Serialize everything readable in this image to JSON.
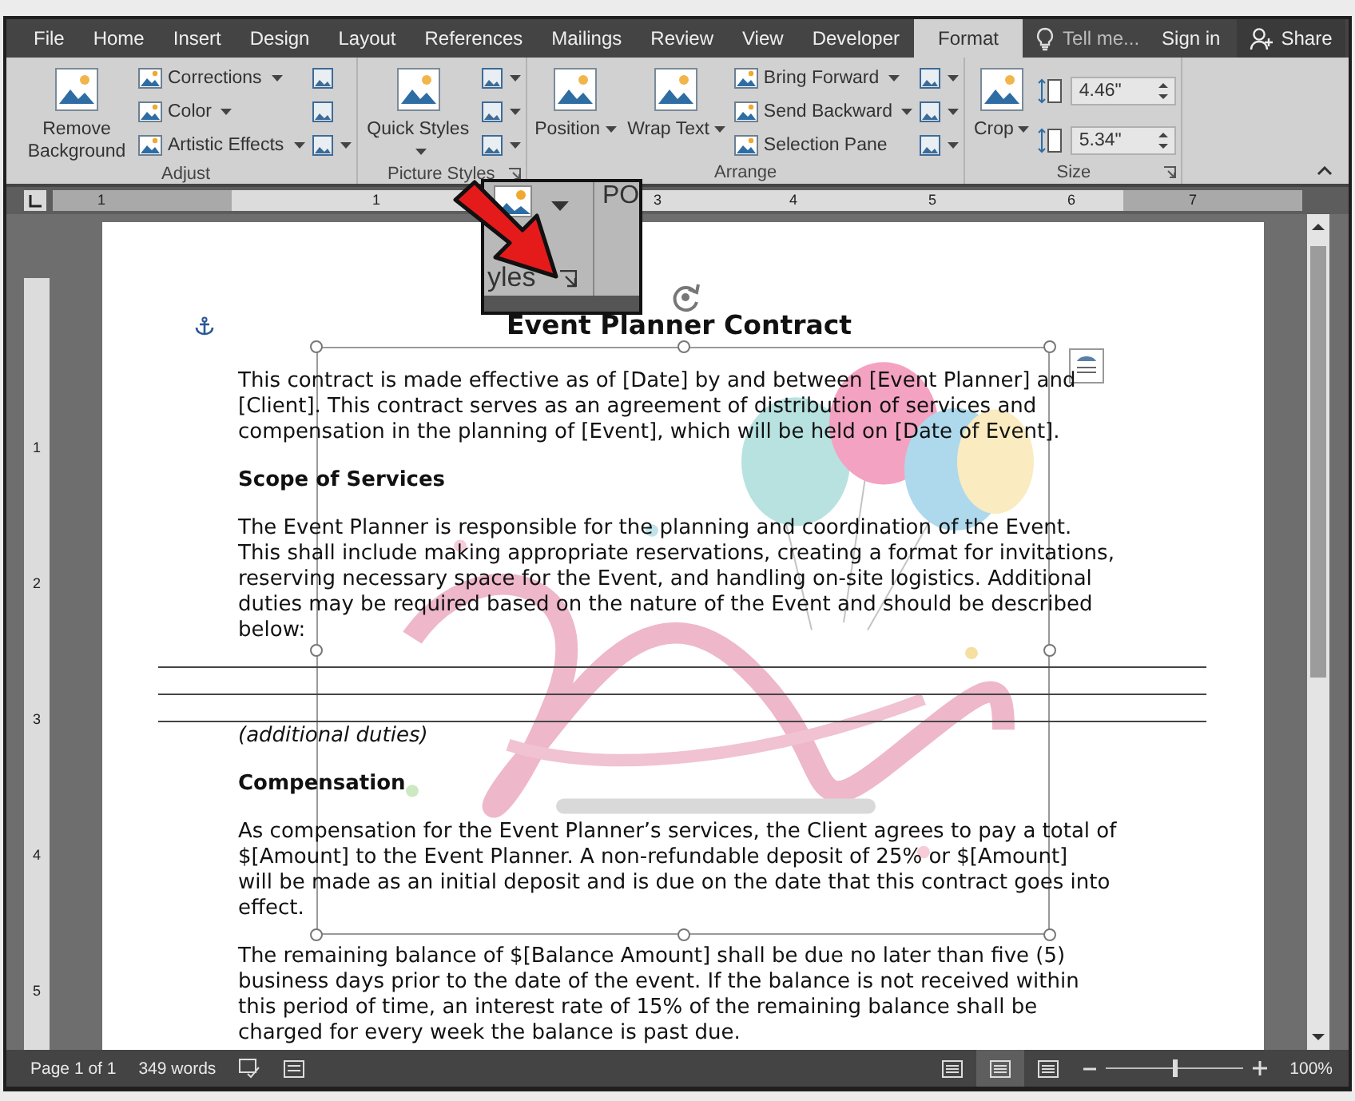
{
  "tabs": [
    {
      "label": "File",
      "selected": false
    },
    {
      "label": "Home",
      "selected": false
    },
    {
      "label": "Insert",
      "selected": false
    },
    {
      "label": "Design",
      "selected": false
    },
    {
      "label": "Layout",
      "selected": false
    },
    {
      "label": "References",
      "selected": false
    },
    {
      "label": "Mailings",
      "selected": false
    },
    {
      "label": "Review",
      "selected": false
    },
    {
      "label": "View",
      "selected": false
    },
    {
      "label": "Developer",
      "selected": false
    },
    {
      "label": "Format",
      "selected": true
    }
  ],
  "tell_me": {
    "placeholder": "Tell me..."
  },
  "account": {
    "sign_in": "Sign in",
    "share": "Share"
  },
  "ribbon": {
    "groups": [
      {
        "label": "Adjust",
        "launcher": false,
        "items": [
          {
            "kind": "large",
            "label": "Remove Background",
            "dropdown": false
          },
          {
            "kind": "column",
            "buttons": [
              {
                "label": "Corrections",
                "dropdown": true
              },
              {
                "label": "Color",
                "dropdown": true
              },
              {
                "label": "Artistic Effects",
                "dropdown": true
              }
            ]
          },
          {
            "kind": "icons",
            "buttons": [
              {
                "dropdown": false
              },
              {
                "dropdown": false
              },
              {
                "dropdown": true
              }
            ]
          }
        ]
      },
      {
        "label": "Picture Styles",
        "launcher": true,
        "items": [
          {
            "kind": "large",
            "label": "Quick Styles",
            "dropdown": true
          },
          {
            "kind": "icons",
            "buttons": [
              {
                "dropdown": true
              },
              {
                "dropdown": true
              },
              {
                "dropdown": true
              }
            ]
          }
        ]
      },
      {
        "label": "Arrange",
        "launcher": false,
        "items": [
          {
            "kind": "large",
            "label": "Position",
            "dropdown": true
          },
          {
            "kind": "large",
            "label": "Wrap Text",
            "dropdown": true
          },
          {
            "kind": "column",
            "buttons": [
              {
                "label": "Bring Forward",
                "dropdown": true
              },
              {
                "label": "Send Backward",
                "dropdown": true
              },
              {
                "label": "Selection Pane",
                "dropdown": false
              }
            ]
          },
          {
            "kind": "icons",
            "buttons": [
              {
                "dropdown": true
              },
              {
                "dropdown": true
              },
              {
                "dropdown": true
              }
            ]
          }
        ]
      },
      {
        "label": "Size",
        "launcher": true,
        "items": [
          {
            "kind": "large",
            "label": "Crop",
            "dropdown": true
          },
          {
            "kind": "spins",
            "fields": [
              {
                "value": "4.46\""
              },
              {
                "value": "5.34\""
              }
            ]
          }
        ]
      }
    ]
  },
  "ruler": {
    "labels": [
      "1",
      "1",
      "3",
      "4",
      "5",
      "6",
      "7"
    ]
  },
  "vertical_ruler": {
    "labels": [
      "1",
      "2",
      "3",
      "4",
      "5"
    ]
  },
  "callout": {
    "text": "yles",
    "partial_text": "PO"
  },
  "document": {
    "blocks": [
      {
        "kind": "title",
        "text": "Event Planner Contract"
      },
      {
        "kind": "paragraph",
        "text": "This contract is made effective as of [Date] by and between [Event Planner] and\n[Client]. This contract serves as an agreement of distribution of services and\ncompensation in the planning of [Event], which will be held on [Date of Event]."
      },
      {
        "kind": "heading",
        "text": "Scope of Services"
      },
      {
        "kind": "paragraph",
        "text": "The Event Planner is responsible for the planning and coordination of the Event.\nThis shall include making appropriate reservations, creating a format for invitations,\nreserving necessary space for the Event, and handling on-site logistics. Additional\nduties may be required based on the nature of the Event and should be described\nbelow:"
      },
      {
        "kind": "lines"
      },
      {
        "kind": "note",
        "text": "(additional duties)"
      },
      {
        "kind": "heading",
        "text": "Compensation"
      },
      {
        "kind": "paragraph",
        "text": "As compensation for the Event Planner’s services, the Client agrees to pay a total of\n$[Amount] to the Event Planner. A non-refundable deposit of 25% or $[Amount]\nwill be made as an initial deposit and is due on the date that this contract goes into\neffect."
      },
      {
        "kind": "paragraph",
        "text": "The remaining balance of $[Balance Amount] shall be due no later than five (5)\nbusiness days prior to the date of the event. If the balance is not received within\nthis period of time, an interest rate of 15% of the remaining balance shall be\ncharged for every week the balance is past due."
      }
    ]
  },
  "status_bar": {
    "page": "Page 1 of 1",
    "words": "349 words",
    "views": [
      {
        "selected": false
      },
      {
        "selected": true
      },
      {
        "selected": false
      }
    ],
    "zoom": {
      "level": 0.5,
      "reading": "100%"
    }
  }
}
